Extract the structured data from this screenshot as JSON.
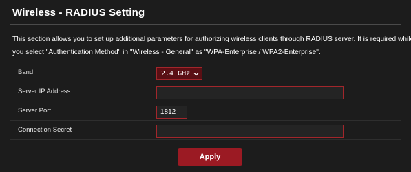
{
  "page": {
    "title": "Wireless - RADIUS Setting",
    "description_line1": "This section allows you to set up additional parameters for authorizing wireless clients through RADIUS server. It is required while",
    "description_line2": "you select \"Authentication Method\" in \"Wireless - General\" as \"WPA-Enterprise / WPA2-Enterprise\"."
  },
  "form": {
    "band": {
      "label": "Band",
      "selected": "2.4 GHz"
    },
    "server_ip": {
      "label": "Server IP Address",
      "value": ""
    },
    "server_port": {
      "label": "Server Port",
      "value": "1812"
    },
    "connection_secret": {
      "label": "Connection Secret",
      "value": ""
    }
  },
  "actions": {
    "apply_label": "Apply"
  },
  "icons": {
    "band_dropdown": "chevron-down-icon"
  },
  "colors": {
    "background": "#1c1c1c",
    "accent": "#9b1a23",
    "input_border": "#a2262b",
    "select_background": "#5a0f14"
  }
}
